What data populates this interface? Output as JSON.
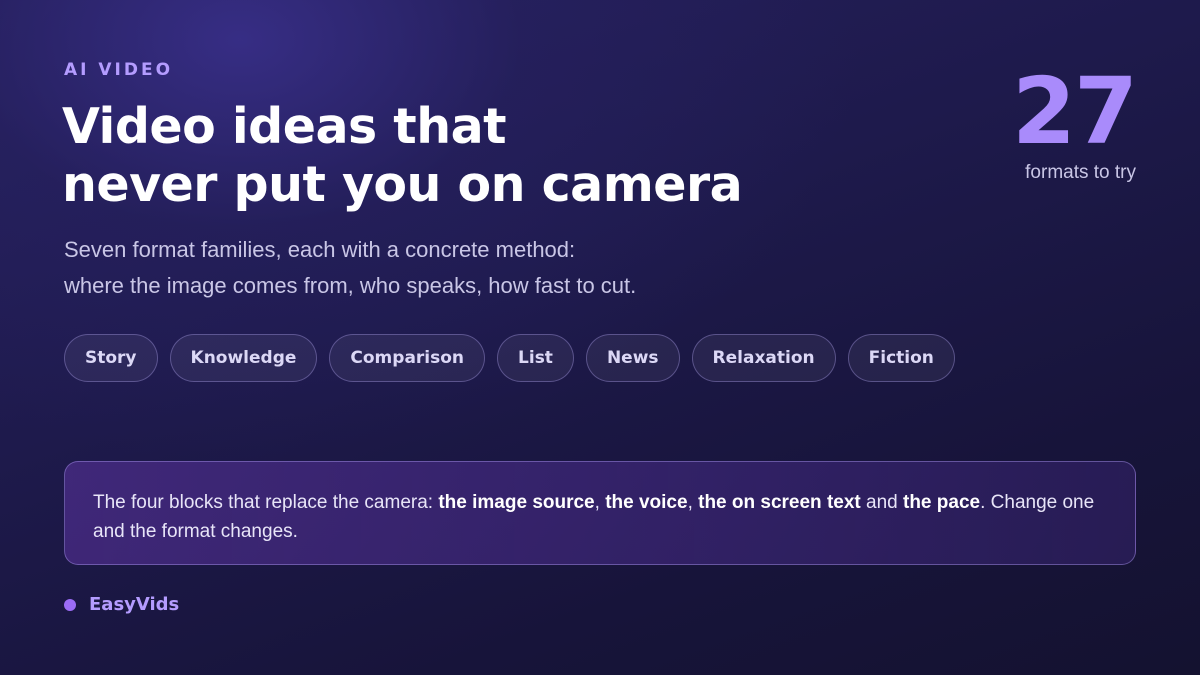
{
  "eyebrow": "AI VIDEO",
  "title": {
    "line1": "Video ideas that",
    "line2": "never put you on camera"
  },
  "subtitle": {
    "line1": "Seven format families, each with a concrete method:",
    "line2": "where the image comes from, who speaks, how fast to cut."
  },
  "stat": {
    "number": "27",
    "label": "formats to try"
  },
  "chips": [
    "Story",
    "Knowledge",
    "Comparison",
    "List",
    "News",
    "Relaxation",
    "Fiction"
  ],
  "callout": {
    "intro": "The four blocks that replace the camera: ",
    "block1": "the image source",
    "sep1": ", ",
    "block2": "the voice",
    "sep2": ", ",
    "block3": "the on screen text",
    "and": " and ",
    "block4": "the pace",
    "outro": ". Change one and the format changes."
  },
  "brand": {
    "name": "EasyVids"
  },
  "colors": {
    "accent": "#b49cff",
    "stat": "#a98bfb",
    "brand_dot": "#9b6cf6",
    "background": "#1e1a4c"
  }
}
